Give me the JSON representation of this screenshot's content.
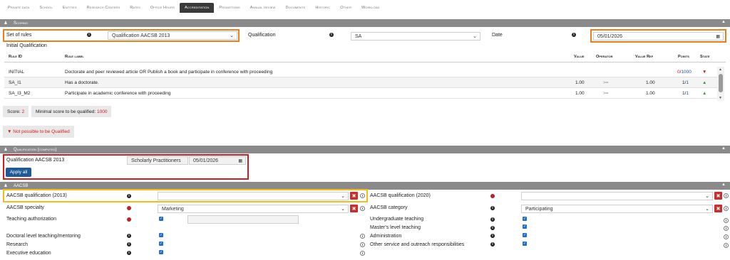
{
  "tabs": [
    "Private data",
    "School",
    "Entities",
    "Research Centers",
    "Rates",
    "Office Hours",
    "Accreditation",
    "Promotions",
    "Annual review",
    "Documents",
    "Historic",
    "Other",
    "Workload"
  ],
  "active_tab": "Accreditation",
  "scoring": {
    "section_title": "Scoring",
    "set_of_rules_label": "Set of rules",
    "set_of_rules_value": "Qualification AACSB 2013",
    "qualification_label": "Qualification",
    "qualification_value": "SA",
    "date_label": "Date",
    "date_value": "05/01/2026",
    "initial_qualification": "Initial Qualification",
    "columns": {
      "rule_id": "Rule ID",
      "rule_label": "Rule label",
      "value": "Value",
      "operator": "Operator",
      "value_ref": "Value Ref",
      "points": "Points",
      "state": "State"
    },
    "rows": [
      {
        "id": "INITIAL",
        "label": "Doctorate and peer reviewed article OR Publish a book and participate in conference with proceeding",
        "value": "",
        "operator": "",
        "value_ref": "",
        "points_a": "0",
        "points_b": "1000",
        "state": "down"
      },
      {
        "id": "SA_I1",
        "label": "Has a doctorate.",
        "value": "1.00",
        "operator": ">=",
        "value_ref": "1.00",
        "points_a": "1",
        "points_b": "1",
        "state": "up"
      },
      {
        "id": "SA_I3_M2",
        "label": "Participate in academic conference with proceeding",
        "value": "1.00",
        "operator": ">=",
        "value_ref": "1.00",
        "points_a": "1",
        "points_b": "1",
        "state": "up"
      }
    ],
    "score_label": "Score:",
    "score_value": "2",
    "min_score_label": "Minimal score to be qualified:",
    "min_score_value": "1000",
    "not_possible": "Not possible to be Qualified"
  },
  "qualification_computed": {
    "section_title": "Qualification (computed)",
    "label": "Qualification AACSB 2013",
    "value": "Scholarly Practitioners",
    "date": "05/01/2026",
    "apply_all": "Apply all"
  },
  "aacsb": {
    "section_title": "AACSB",
    "left": [
      {
        "label": "AACSB qualification (2013)",
        "info": "dark"
      },
      {
        "label": "AACSB specialty",
        "info": "red",
        "value": "Marketing"
      },
      {
        "label": "Teaching authorization",
        "info": "red"
      },
      {
        "label": "Doctoral level teaching/mentoring",
        "info": "dark"
      },
      {
        "label": "Research",
        "info": "dark"
      },
      {
        "label": "Executive education",
        "info": "dark"
      }
    ],
    "right": [
      {
        "label": "AACSB qualification (2020)",
        "info": "red"
      },
      {
        "label": "AACSB category",
        "info": "dark",
        "value": "Participating"
      },
      {
        "label": "Undergraduate teaching",
        "info": "dark"
      },
      {
        "label": "Master's level teaching",
        "info": "dark"
      },
      {
        "label": "Administration",
        "info": "dark"
      },
      {
        "label": "Other service and outreach responsibilities",
        "info": "dark"
      }
    ]
  },
  "colors": {
    "highlight_orange": "#f07c1a",
    "highlight_red": "#d71920",
    "highlight_yellow": "#f3bb1c",
    "primary_button": "#1f5a96"
  }
}
